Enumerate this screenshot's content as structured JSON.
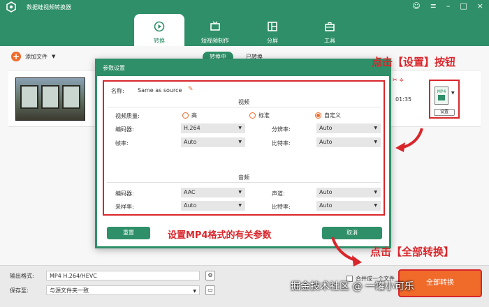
{
  "app": {
    "title": "数据蛙视频转换器",
    "window_controls": [
      "☺",
      "≡",
      "–",
      "□",
      "×"
    ]
  },
  "nav": {
    "tabs": [
      {
        "label": "转换",
        "icon": "convert-icon",
        "active": true
      },
      {
        "label": "短视频制作",
        "icon": "tv-icon",
        "active": false
      },
      {
        "label": "分屏",
        "icon": "split-screen-icon",
        "active": false
      },
      {
        "label": "工具",
        "icon": "toolbox-icon",
        "active": false
      }
    ]
  },
  "toolbar": {
    "add_file": "添加文件",
    "sub_tabs": [
      "转换中",
      "已转换"
    ]
  },
  "file": {
    "duration": "01:35",
    "settings_label": "设置",
    "format_tag": "MP4"
  },
  "bottom": {
    "output_format_label": "输出格式:",
    "output_format_value": "MP4 H.264/HEVC",
    "save_to_label": "保存至:",
    "save_to_value": "与源文件夹一致",
    "merge_label": "合并成一个文件",
    "convert_all": "全部转换"
  },
  "dialog": {
    "title": "参数设置",
    "name_label": "名称:",
    "name_value": "Same as source",
    "video_section": "视频",
    "quality_label": "视频质量:",
    "quality_options": [
      "高",
      "标准",
      "自定义"
    ],
    "quality_selected": "自定义",
    "encoder_label": "编码器:",
    "encoder_value": "H.264",
    "resolution_label": "分辨率:",
    "resolution_value": "Auto",
    "framerate_label": "帧率:",
    "framerate_value": "Auto",
    "bitrate_label": "比特率:",
    "bitrate_value": "Auto",
    "audio_section": "音频",
    "audio_encoder_label": "编码器:",
    "audio_encoder_value": "AAC",
    "channel_label": "声道:",
    "channel_value": "Auto",
    "samplerate_label": "采样率:",
    "samplerate_value": "Auto",
    "audio_bitrate_label": "比特率:",
    "audio_bitrate_value": "Auto",
    "reset_button": "重置",
    "cancel_button": "取消"
  },
  "annotations": {
    "settings_note": "点击【设置】按钮",
    "params_note": "设置MP4格式的有关参数",
    "convert_note": "点击【全部转换】"
  },
  "watermark": "掘金技术社区 @ 一罐小可乐",
  "colors": {
    "brand_green": "#2e8f68",
    "accent_orange": "#f06a2a",
    "annotation_red": "#d9262b"
  }
}
